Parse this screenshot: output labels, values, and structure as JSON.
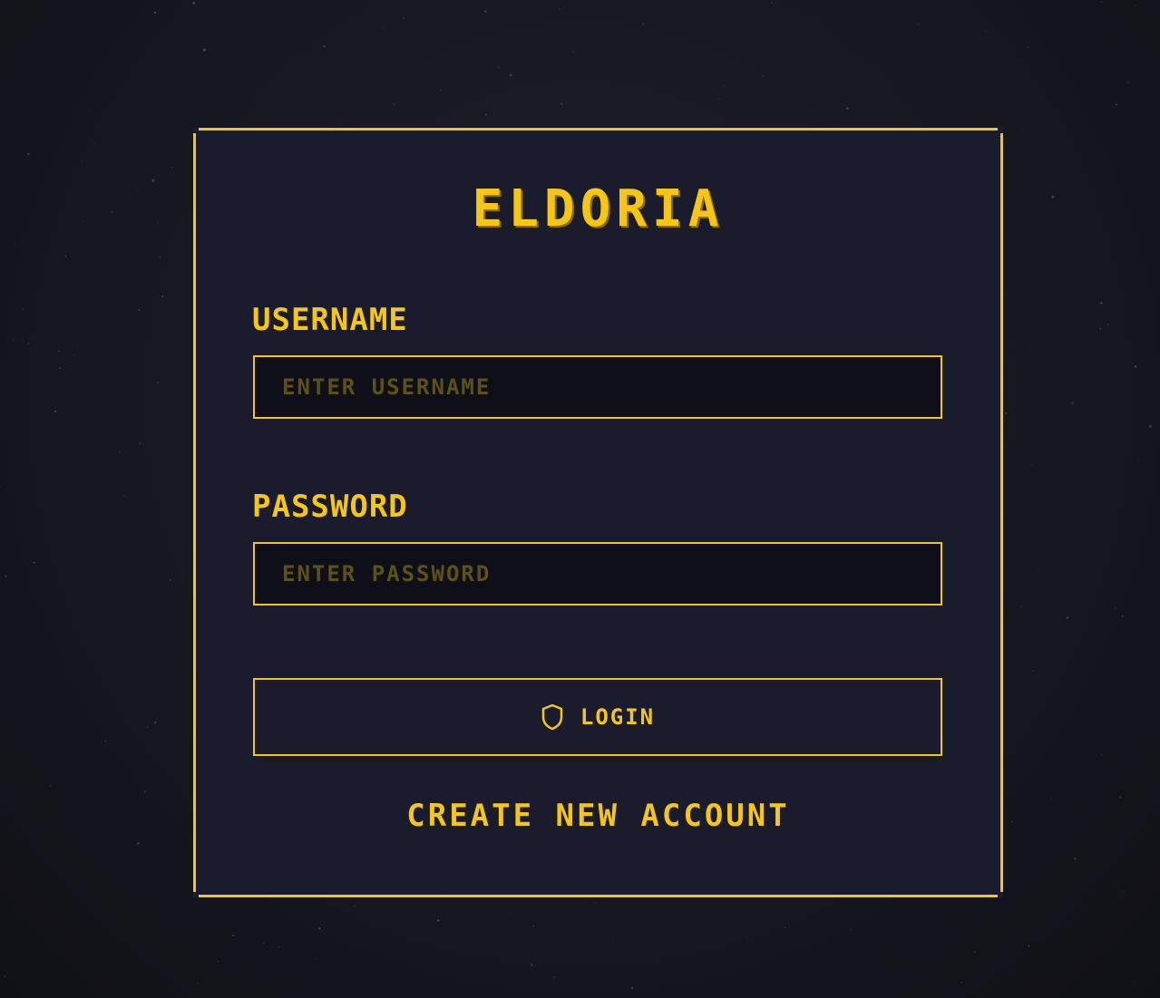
{
  "app": {
    "title": "ELDORIA"
  },
  "form": {
    "username_label": "USERNAME",
    "username_placeholder": "ENTER USERNAME",
    "username_value": "",
    "password_label": "PASSWORD",
    "password_placeholder": "ENTER PASSWORD",
    "password_value": "",
    "login_label": "LOGIN",
    "login_icon": "shield-icon",
    "create_account_label": "CREATE NEW ACCOUNT"
  },
  "colors": {
    "accent": "#f5c518",
    "panel_background": "#1a1b2d",
    "input_background": "#0e0f18",
    "placeholder": "#5e5115",
    "page_background": "#16171f"
  }
}
